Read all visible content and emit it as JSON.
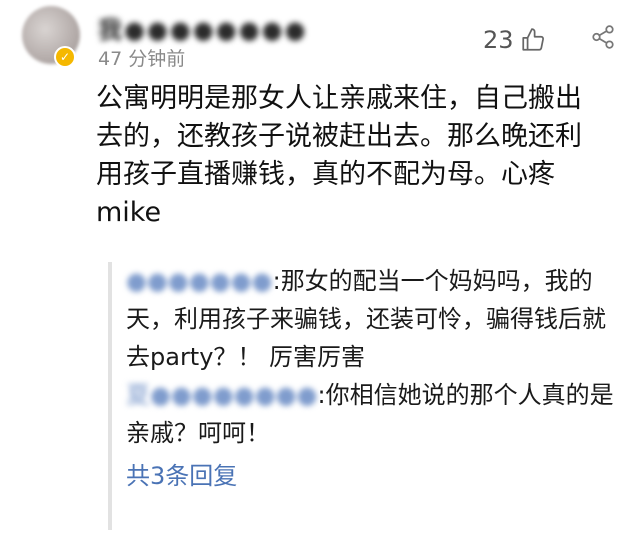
{
  "comment": {
    "username": "我●●●●●●●●",
    "time": "47 分钟前",
    "likes": "23",
    "text": "公寓明明是那女人让亲戚来住，自己搬出\n去的，还教孩子说被赶出去。那么晚还利\n用孩子直播赚钱，真的不配为母。心疼\nmike"
  },
  "replies": [
    {
      "name": "●●●●●●●",
      "separator": ":",
      "text": "那女的配当一个妈妈吗，我的天，利用孩子来骗钱，还装可怜，骗得钱后就去party？！ 厉害厉害"
    },
    {
      "name": "夏●●●●●●●●",
      "separator": ":",
      "text": "你相信她说的那个人真的是亲戚？呵呵！"
    }
  ],
  "more_replies": "共3条回复",
  "colors": {
    "reply_link": "#4a73b5",
    "name_blur": "#7f9ccd",
    "verified_badge": "#f5b800"
  },
  "icons": {
    "like": "thumb-up-icon",
    "share": "share-icon",
    "badge": "verified-badge-icon"
  }
}
